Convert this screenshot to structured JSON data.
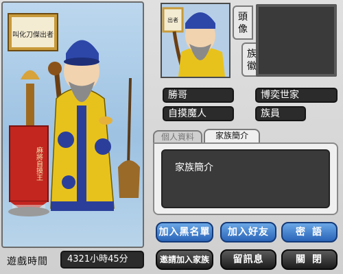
{
  "stage": {
    "certificate_text": "叫化刀傑出者",
    "banner_text": "麻將自摸王"
  },
  "status": {
    "time_label": "遊戲時間",
    "time_value": "4321小時45分"
  },
  "profile": {
    "portrait_certificate_text": "出者",
    "head_tab_label": "頭像",
    "emblem_tab_label": "族徽",
    "name": "勝哥",
    "family": "博奕世家",
    "title": "自摸魔人",
    "role": "族員"
  },
  "tabs": {
    "personal": "個人資料",
    "family_intro": "家族簡介"
  },
  "panel": {
    "content": "家族簡介"
  },
  "buttons": {
    "blacklist": "加入黑名單",
    "add_friend": "加入好友",
    "whisper": "密語",
    "invite_family": "邀請加入家族",
    "leave_message": "留訊息",
    "close": "關閉"
  },
  "colors": {
    "robe": "#e8c21c",
    "robe_trim": "#2b3f9a",
    "banner": "#c2261f",
    "stage_bg": "#a9cbe8"
  }
}
